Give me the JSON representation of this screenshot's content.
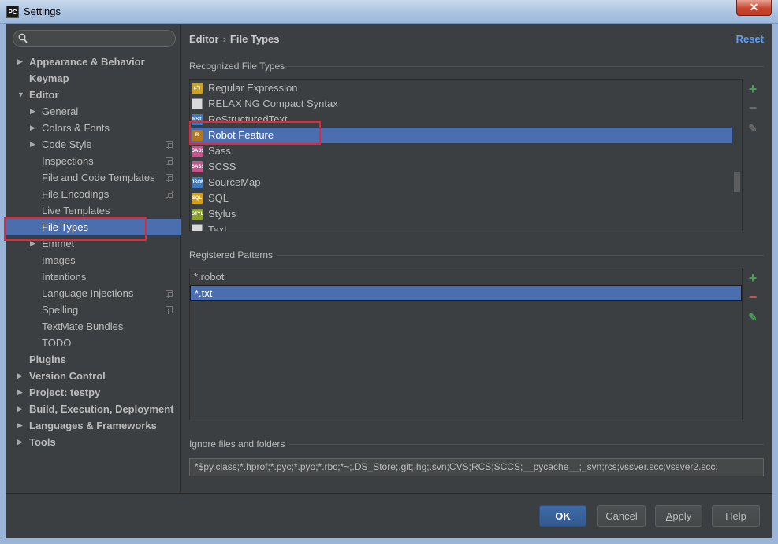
{
  "window": {
    "title": "Settings",
    "app_badge": "PC",
    "close_glyph": "✕"
  },
  "search": {
    "placeholder": ""
  },
  "sidebar": {
    "items": [
      {
        "label": "Appearance & Behavior",
        "level": 0,
        "arrow": "right",
        "bold": true
      },
      {
        "label": "Keymap",
        "level": 0,
        "arrow": "none",
        "bold": true
      },
      {
        "label": "Editor",
        "level": 0,
        "arrow": "down",
        "bold": true
      },
      {
        "label": "General",
        "level": 1,
        "arrow": "right"
      },
      {
        "label": "Colors & Fonts",
        "level": 1,
        "arrow": "right"
      },
      {
        "label": "Code Style",
        "level": 1,
        "arrow": "right",
        "project": true
      },
      {
        "label": "Inspections",
        "level": 1,
        "arrow": "none",
        "project": true
      },
      {
        "label": "File and Code Templates",
        "level": 1,
        "arrow": "none",
        "project": true
      },
      {
        "label": "File Encodings",
        "level": 1,
        "arrow": "none",
        "project": true
      },
      {
        "label": "Live Templates",
        "level": 1,
        "arrow": "none"
      },
      {
        "label": "File Types",
        "level": 1,
        "arrow": "none",
        "selected": true
      },
      {
        "label": "Emmet",
        "level": 1,
        "arrow": "right"
      },
      {
        "label": "Images",
        "level": 1,
        "arrow": "none"
      },
      {
        "label": "Intentions",
        "level": 1,
        "arrow": "none"
      },
      {
        "label": "Language Injections",
        "level": 1,
        "arrow": "none",
        "project": true
      },
      {
        "label": "Spelling",
        "level": 1,
        "arrow": "none",
        "project": true
      },
      {
        "label": "TextMate Bundles",
        "level": 1,
        "arrow": "none"
      },
      {
        "label": "TODO",
        "level": 1,
        "arrow": "none"
      },
      {
        "label": "Plugins",
        "level": 0,
        "arrow": "none",
        "bold": true
      },
      {
        "label": "Version Control",
        "level": 0,
        "arrow": "right",
        "bold": true
      },
      {
        "label": "Project: testpy",
        "level": 0,
        "arrow": "right",
        "bold": true
      },
      {
        "label": "Build, Execution, Deployment",
        "level": 0,
        "arrow": "right",
        "bold": true
      },
      {
        "label": "Languages & Frameworks",
        "level": 0,
        "arrow": "right",
        "bold": true
      },
      {
        "label": "Tools",
        "level": 0,
        "arrow": "right",
        "bold": true
      }
    ]
  },
  "main": {
    "breadcrumb": {
      "parent": "Editor",
      "separator": "›",
      "current": "File Types"
    },
    "reset_label": "Reset",
    "recognized": {
      "title": "Recognized File Types",
      "items": [
        {
          "label": "Regular Expression",
          "icon": "regex-icon",
          "badge": "(.*)",
          "color": "#c9a227"
        },
        {
          "label": "RELAX NG Compact Syntax",
          "icon": "text-file-icon",
          "badge": "",
          "color": "#d9d9d9"
        },
        {
          "label": "ReStructuredText",
          "icon": "rst-icon",
          "badge": "RST",
          "color": "#3a7bbf"
        },
        {
          "label": "Robot Feature",
          "icon": "robot-icon",
          "badge": "R",
          "color": "#b5771d",
          "selected": true
        },
        {
          "label": "Sass",
          "icon": "sass-icon",
          "badge": "SASS",
          "color": "#c6538c"
        },
        {
          "label": "SCSS",
          "icon": "scss-icon",
          "badge": "SASS",
          "color": "#c6538c"
        },
        {
          "label": "SourceMap",
          "icon": "json-icon",
          "badge": "JSON",
          "color": "#3a7bbf"
        },
        {
          "label": "SQL",
          "icon": "sql-icon",
          "badge": "SQL",
          "color": "#d4a017"
        },
        {
          "label": "Stylus",
          "icon": "styl-icon",
          "badge": "STYL",
          "color": "#8aa12a"
        },
        {
          "label": "Text",
          "icon": "text-file-icon",
          "badge": "",
          "color": "#d9d9d9"
        }
      ],
      "scroll_fraction": 0.52
    },
    "patterns": {
      "title": "Registered Patterns",
      "items": [
        {
          "label": "*.robot"
        },
        {
          "label": "*.txt",
          "selected": true
        }
      ]
    },
    "tools": {
      "add": "+",
      "remove": "−",
      "edit": "✎"
    },
    "ignore": {
      "title": "Ignore files and folders",
      "value": "*$py.class;*.hprof;*.pyc;*.pyo;*.rbc;*~;.DS_Store;.git;.hg;.svn;CVS;RCS;SCCS;__pycache__;_svn;rcs;vssver.scc;vssver2.scc;"
    }
  },
  "footer": {
    "ok": "OK",
    "cancel": "Cancel",
    "apply_mnemonic": "A",
    "apply_rest": "pply",
    "help": "Help"
  },
  "colors": {
    "background": "#3c3f41",
    "selection": "#4b6eaf",
    "add_green": "#499c54",
    "remove_red": "#c75450",
    "link_blue": "#589df6",
    "highlight_red": "#e0293b"
  }
}
